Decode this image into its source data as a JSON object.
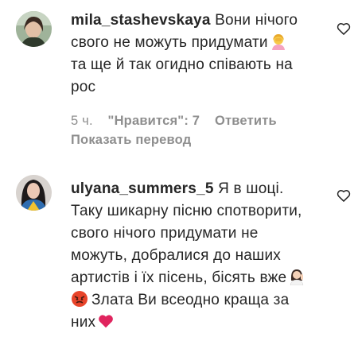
{
  "comments": [
    {
      "username": "mila_stashevskaya",
      "text": "Вони нічого свого не можуть придумати",
      "text_after_emoji": "та ще й так огидно співають на рос",
      "emoji": "woman-facepalming-emoji",
      "time": "5 ч.",
      "likes": "\"Нравится\": 7",
      "reply": "Ответить",
      "translate": "Показать перевод"
    },
    {
      "username": "ulyana_summers_5",
      "text": "Я в шоці. Таку шикарну пісню спотворити, свого нічого придумати не можуть, добралися до наших артистів і їх пісень, бісять вже",
      "text_mid": "Злата Ви всеодно краща за них",
      "emojis": [
        "woman-raising-hand-emoji",
        "angry-face-emoji",
        "red-heart-emoji"
      ]
    }
  ],
  "colors": {
    "text": "#262626",
    "meta": "#8e8e8e",
    "heart_outline": "#262626",
    "red_heart": "#e0245e"
  }
}
